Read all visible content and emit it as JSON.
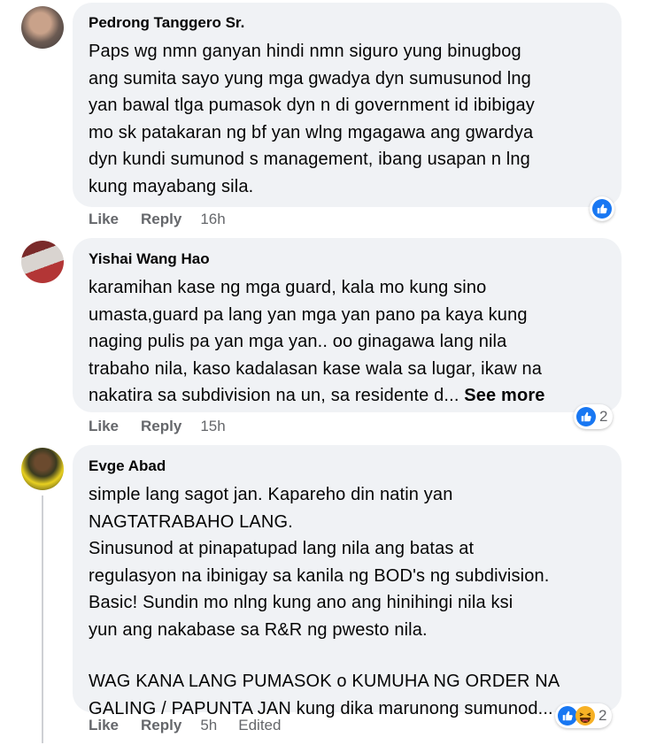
{
  "comments": [
    {
      "author": "Pedrong Tanggero Sr.",
      "lines": [
        "Paps wg nmn ganyan hindi nmn siguro yung binugbog",
        "ang sumita sayo yung mga gwadya dyn sumusunod lng",
        "yan bawal tlga pumasok dyn n di government id ibibigay",
        "mo sk patakaran ng bf yan wlng mgagawa ang gwardya",
        "dyn kundi sumunod s management, ibang usapan n lng",
        "kung mayabang sila."
      ],
      "like_label": "Like",
      "reply_label": "Reply",
      "time": "16h",
      "reaction_icon": "like-icon"
    },
    {
      "author": "Yishai Wang Hao",
      "lines": [
        "karamihan kase ng mga guard, kala mo kung sino",
        "umasta,guard pa lang yan mga yan pano pa kaya kung",
        "naging pulis pa yan mga yan.. oo ginagawa lang nila",
        "trabaho nila, kaso kadalasan kase wala sa lugar, ikaw na"
      ],
      "last_line": "nakatira sa subdivision na un, sa residente d...",
      "see_more": "See more",
      "like_label": "Like",
      "reply_label": "Reply",
      "time": "15h",
      "reaction_icon": "like-icon",
      "reaction_count": "2"
    },
    {
      "author": "Evge Abad",
      "lines_a": [
        "simple lang sagot jan. Kapareho din natin yan",
        "NAGTATRABAHO LANG.",
        "Sinusunod at pinapatupad lang nila ang batas at",
        "regulasyon na ibinigay sa kanila ng BOD's ng subdivision.",
        "Basic! Sundin mo nlng kung ano ang hinihingi nila ksi",
        "yun ang nakabase sa R&R ng pwesto nila."
      ],
      "lines_b": [
        "WAG KANA LANG PUMASOK o KUMUHA NG ORDER NA",
        "GALING / PAPUNTA JAN kung dika marunong sumunod..."
      ],
      "like_label": "Like",
      "reply_label": "Reply",
      "time": "5h",
      "edited_label": "Edited",
      "reaction_icons": [
        "like-icon",
        "haha-icon"
      ],
      "reaction_count": "2"
    }
  ],
  "colors": {
    "bubble": "#f0f2f5",
    "secondary_text": "#65676b",
    "like_blue": "#1877f2",
    "haha_yellow": "#f7b125"
  }
}
